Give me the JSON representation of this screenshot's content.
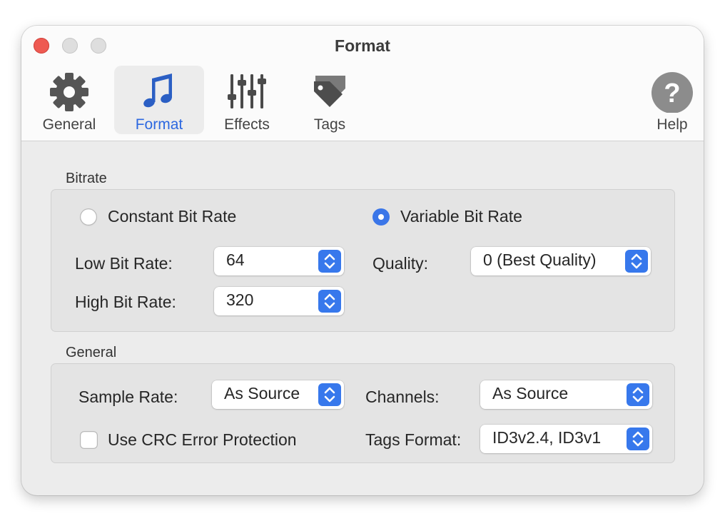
{
  "window": {
    "title": "Format"
  },
  "toolbar": {
    "items": [
      {
        "label": "General",
        "icon": "gear-icon"
      },
      {
        "label": "Format",
        "icon": "music-note-icon",
        "selected": true
      },
      {
        "label": "Effects",
        "icon": "sliders-icon"
      },
      {
        "label": "Tags",
        "icon": "tag-icon"
      }
    ],
    "help_label": "Help"
  },
  "bitrate": {
    "section_label": "Bitrate",
    "constant_label": "Constant Bit Rate",
    "constant_selected": false,
    "variable_label": "Variable Bit Rate",
    "variable_selected": true,
    "low_label": "Low Bit Rate:",
    "low_value": "64",
    "high_label": "High Bit Rate:",
    "high_value": "320",
    "quality_label": "Quality:",
    "quality_value": "0 (Best Quality)"
  },
  "general": {
    "section_label": "General",
    "sample_rate_label": "Sample Rate:",
    "sample_rate_value": "As Source",
    "channels_label": "Channels:",
    "channels_value": "As Source",
    "crc_label": "Use CRC Error Protection",
    "crc_checked": false,
    "tags_format_label": "Tags Format:",
    "tags_format_value": "ID3v2.4, ID3v1"
  },
  "colors": {
    "accent": "#3778ec",
    "close": "#ee5a52",
    "selected_label": "#2c68e0"
  }
}
